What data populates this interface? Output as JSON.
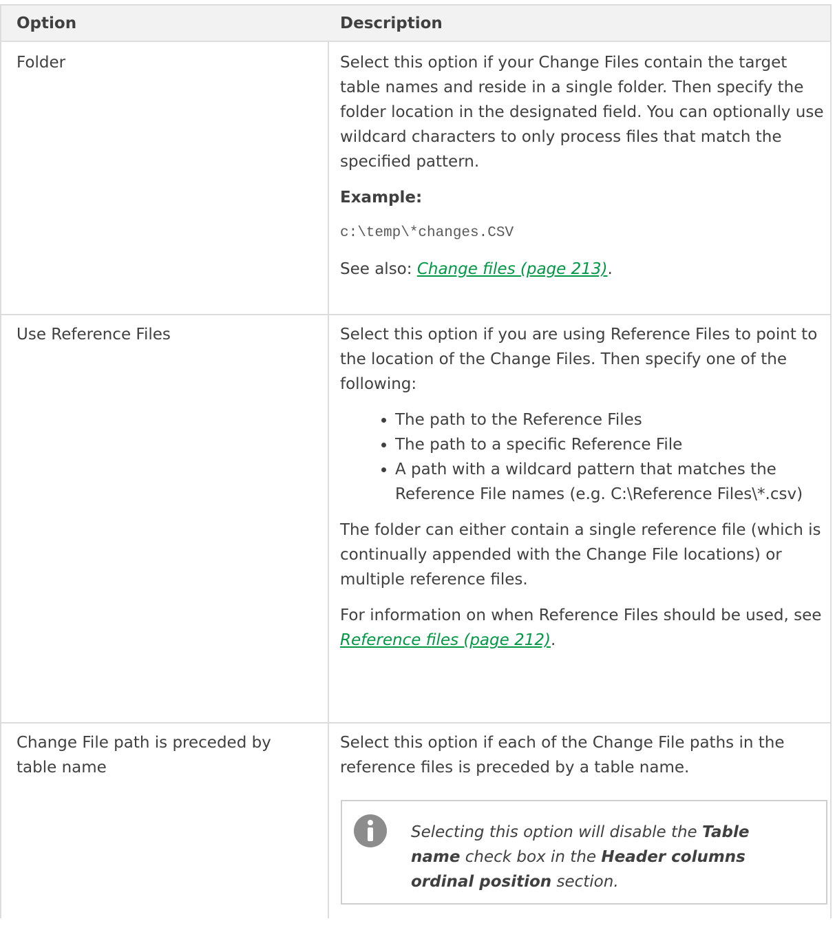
{
  "header": {
    "option": "Option",
    "description": "Description"
  },
  "folder": {
    "label": "Folder",
    "desc": "Select this option if your Change Files contain the target table names and reside in a single folder. Then specify the folder location in the designated field. You can optionally use wildcard characters to only process files that match the specified pattern.",
    "example_label": "Example:",
    "example_code": "c:\\temp\\*changes.CSV",
    "see_also_prefix": "See also: ",
    "see_also_link": "Change files (page 213)",
    "see_also_suffix": "."
  },
  "reference": {
    "label": "Use Reference Files",
    "desc": "Select this option if you are using Reference Files to point to the location of the Change Files. Then specify one of the following:",
    "bullets": [
      "The path to the Reference Files",
      "The path to a specific Reference File",
      "A path with a wildcard pattern that matches the Reference File names (e.g. C:\\Reference Files\\*.csv)"
    ],
    "para2": "The folder can either contain a single reference file (which is continually appended with the Change File locations) or multiple reference files.",
    "para3_prefix": "For information on when Reference Files should be used, see ",
    "para3_link": "Reference files (page 212)",
    "para3_suffix": "."
  },
  "change_path": {
    "label": "Change File path is preceded by table name",
    "desc": "Select this option if each of the Change File paths in the reference files is preceded by a table name.",
    "note": {
      "icon": "info-icon",
      "t1": "Selecting this option will disable the ",
      "b1": "Table name",
      "t2": " check box in the ",
      "b2": "Header columns ordinal position",
      "t3": " section."
    }
  },
  "colors": {
    "link": "#009845",
    "border": "#dddddd",
    "header_bg": "#f2f2f2",
    "text": "#404040"
  }
}
